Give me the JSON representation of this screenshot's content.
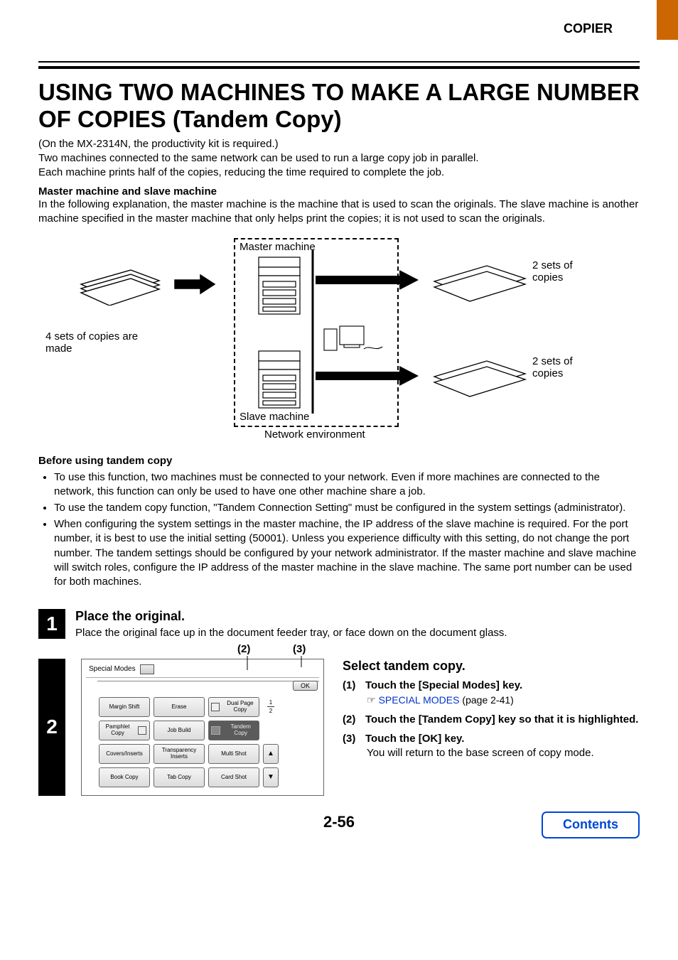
{
  "header": {
    "section": "COPIER"
  },
  "title": "USING TWO MACHINES TO MAKE A LARGE NUMBER OF COPIES (Tandem Copy)",
  "intro": {
    "line1": "(On the MX-2314N, the productivity kit is required.)",
    "line2": "Two machines connected to the same network can be used to run a large copy job in parallel.",
    "line3": "Each machine prints half of the copies, reducing the time required to complete the job."
  },
  "master_slave": {
    "heading": "Master machine and slave machine",
    "text": "In the following explanation, the master machine is the machine that is used to scan the originals. The slave machine is another machine specified in the master machine that only helps print the copies; it is not used to scan the originals."
  },
  "diagram": {
    "left_caption": "4 sets of copies are made",
    "master_label": "Master machine",
    "slave_label": "Slave machine",
    "network_label": "Network environment",
    "out1": "2 sets of copies",
    "out2": "2 sets of copies"
  },
  "before": {
    "heading": "Before using tandem copy",
    "items": [
      "To use this function, two machines must be connected to your network. Even if more machines are connected to the network, this function can only be used to have one other machine share a job.",
      "To use the tandem copy function, \"Tandem Connection Setting\" must be configured in the system settings (administrator).",
      "When configuring the system settings in the master machine, the IP address of the slave machine is required. For the port number, it is best to use the initial setting (50001). Unless you experience difficulty with this setting, do not change the port number. The tandem settings should be configured by your network administrator. If the master machine and slave machine will switch roles, configure the IP address of the master machine in the slave machine. The same port number can be used for both machines."
    ]
  },
  "step1": {
    "num": "1",
    "title": "Place the original.",
    "text": "Place the original face up in the document feeder tray, or face down on the document glass."
  },
  "step2": {
    "num": "2",
    "callout2": "(2)",
    "callout3": "(3)",
    "panel": {
      "title": "Special Modes",
      "ok": "OK",
      "options": {
        "margin_shift": "Margin Shift",
        "erase": "Erase",
        "dual_page": "Dual Page Copy",
        "pamphlet": "Pamphlet Copy",
        "job_build": "Job Build",
        "tandem": "Tandem Copy",
        "covers": "Covers/Inserts",
        "transparency": "Transparency Inserts",
        "multi_shot": "Multi Shot",
        "book_copy": "Book Copy",
        "tab_copy": "Tab Copy",
        "card_shot": "Card Shot"
      },
      "page_indicator": {
        "cur": "1",
        "total": "2"
      },
      "up": "▲",
      "down": "▼"
    },
    "right": {
      "title": "Select tandem copy.",
      "i1_num": "(1)",
      "i1_text": "Touch the [Special Modes] key.",
      "i1_link": "SPECIAL MODES",
      "i1_pageref": "(page 2-41)",
      "i2_num": "(2)",
      "i2_text": "Touch the [Tandem Copy] key so that it is highlighted.",
      "i3_num": "(3)",
      "i3_text": "Touch the [OK] key.",
      "i3_note": "You will return to the base screen of copy mode."
    }
  },
  "footer": {
    "page": "2-56",
    "contents": "Contents"
  }
}
